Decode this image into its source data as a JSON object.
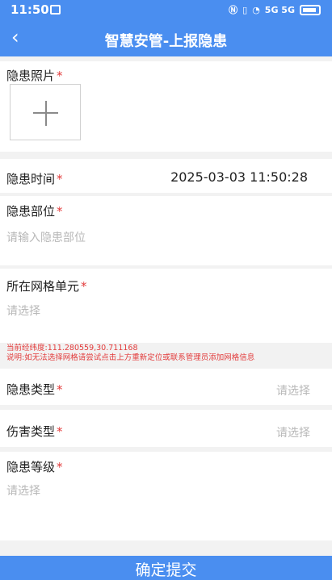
{
  "status_bar": {
    "time": "11:50",
    "signal": "5G 5G",
    "colors": {
      "bar": "#4a8ef0",
      "text": "#ffffff"
    }
  },
  "nav": {
    "title": "智慧安管-上报隐患"
  },
  "form": {
    "photo": {
      "label": "隐患照片"
    },
    "time": {
      "label": "隐患时间",
      "value": "2025-03-03 11:50:28"
    },
    "location": {
      "label": "隐患部位",
      "placeholder": "请输入隐患部位"
    },
    "grid": {
      "label": "所在网格单元",
      "placeholder": "请选择"
    },
    "coordinate": {
      "label": "当前经纬度:111.280559,30.711168",
      "note": "说明:如无法选择网格请尝试点击上方重新定位或联系管理员添加网格信息"
    },
    "hazard_type": {
      "label": "隐患类型",
      "placeholder": "请选择"
    },
    "injury_type": {
      "label": "伤害类型",
      "placeholder": "请选择"
    },
    "level": {
      "label": "隐患等级",
      "placeholder": "请选择"
    }
  },
  "submit_label": "确定提交",
  "icons": {
    "back": "chevron-left-icon",
    "upload": "plus-icon"
  },
  "colors": {
    "accent": "#4a8ef0",
    "required": "#e23b3b",
    "placeholder": "#b8b8b8"
  }
}
